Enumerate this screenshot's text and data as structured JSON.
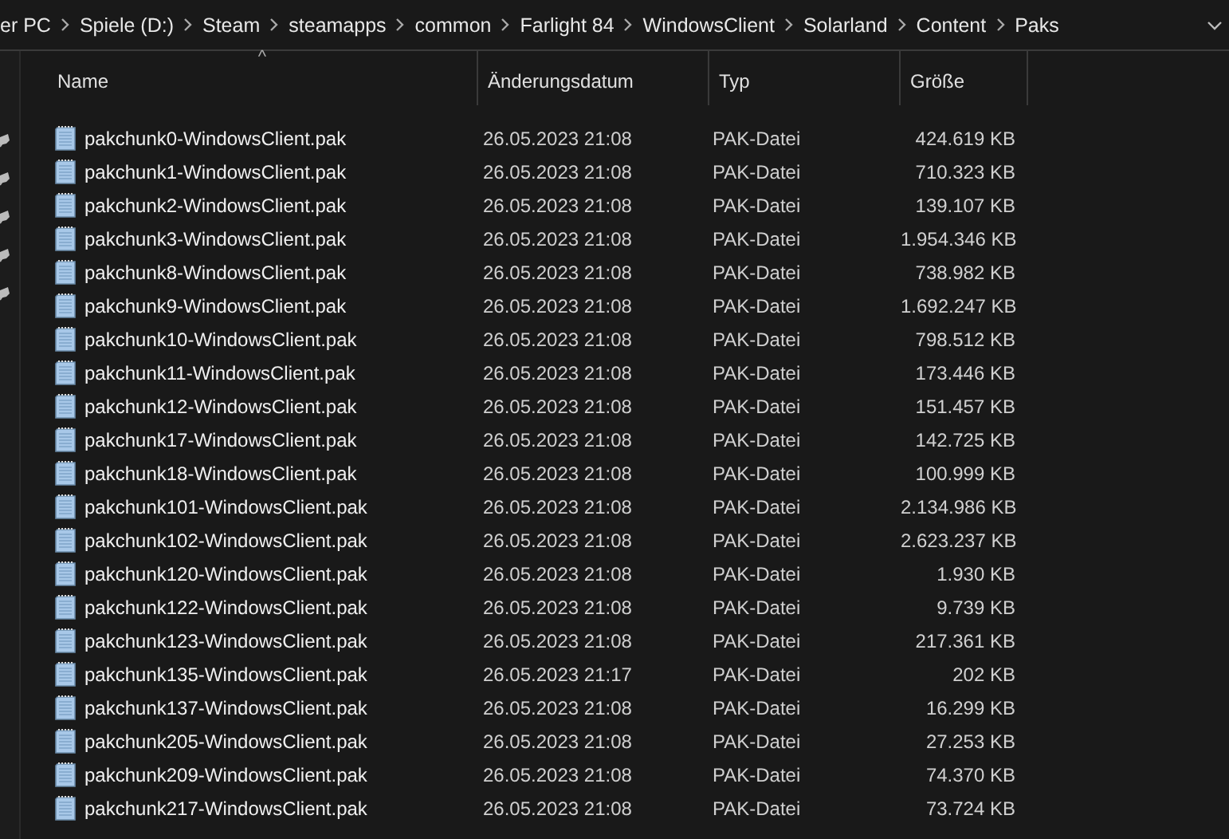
{
  "breadcrumb": [
    "er PC",
    "Spiele (D:)",
    "Steam",
    "steamapps",
    "common",
    "Farlight 84",
    "WindowsClient",
    "Solarland",
    "Content",
    "Paks"
  ],
  "columns": [
    {
      "label": "Name",
      "sorted": true
    },
    {
      "label": "Änderungsdatum",
      "sorted": false
    },
    {
      "label": "Typ",
      "sorted": false
    },
    {
      "label": "Größe",
      "sorted": false
    }
  ],
  "sort_indicator": "^",
  "files": [
    {
      "name": "pakchunk0-WindowsClient.pak",
      "date": "26.05.2023 21:08",
      "type": "PAK-Datei",
      "size": "424.619 KB"
    },
    {
      "name": "pakchunk1-WindowsClient.pak",
      "date": "26.05.2023 21:08",
      "type": "PAK-Datei",
      "size": "710.323 KB"
    },
    {
      "name": "pakchunk2-WindowsClient.pak",
      "date": "26.05.2023 21:08",
      "type": "PAK-Datei",
      "size": "139.107 KB"
    },
    {
      "name": "pakchunk3-WindowsClient.pak",
      "date": "26.05.2023 21:08",
      "type": "PAK-Datei",
      "size": "1.954.346 KB"
    },
    {
      "name": "pakchunk8-WindowsClient.pak",
      "date": "26.05.2023 21:08",
      "type": "PAK-Datei",
      "size": "738.982 KB"
    },
    {
      "name": "pakchunk9-WindowsClient.pak",
      "date": "26.05.2023 21:08",
      "type": "PAK-Datei",
      "size": "1.692.247 KB"
    },
    {
      "name": "pakchunk10-WindowsClient.pak",
      "date": "26.05.2023 21:08",
      "type": "PAK-Datei",
      "size": "798.512 KB"
    },
    {
      "name": "pakchunk11-WindowsClient.pak",
      "date": "26.05.2023 21:08",
      "type": "PAK-Datei",
      "size": "173.446 KB"
    },
    {
      "name": "pakchunk12-WindowsClient.pak",
      "date": "26.05.2023 21:08",
      "type": "PAK-Datei",
      "size": "151.457 KB"
    },
    {
      "name": "pakchunk17-WindowsClient.pak",
      "date": "26.05.2023 21:08",
      "type": "PAK-Datei",
      "size": "142.725 KB"
    },
    {
      "name": "pakchunk18-WindowsClient.pak",
      "date": "26.05.2023 21:08",
      "type": "PAK-Datei",
      "size": "100.999 KB"
    },
    {
      "name": "pakchunk101-WindowsClient.pak",
      "date": "26.05.2023 21:08",
      "type": "PAK-Datei",
      "size": "2.134.986 KB"
    },
    {
      "name": "pakchunk102-WindowsClient.pak",
      "date": "26.05.2023 21:08",
      "type": "PAK-Datei",
      "size": "2.623.237 KB"
    },
    {
      "name": "pakchunk120-WindowsClient.pak",
      "date": "26.05.2023 21:08",
      "type": "PAK-Datei",
      "size": "1.930 KB"
    },
    {
      "name": "pakchunk122-WindowsClient.pak",
      "date": "26.05.2023 21:08",
      "type": "PAK-Datei",
      "size": "9.739 KB"
    },
    {
      "name": "pakchunk123-WindowsClient.pak",
      "date": "26.05.2023 21:08",
      "type": "PAK-Datei",
      "size": "217.361 KB"
    },
    {
      "name": "pakchunk135-WindowsClient.pak",
      "date": "26.05.2023 21:17",
      "type": "PAK-Datei",
      "size": "202 KB"
    },
    {
      "name": "pakchunk137-WindowsClient.pak",
      "date": "26.05.2023 21:08",
      "type": "PAK-Datei",
      "size": "16.299 KB"
    },
    {
      "name": "pakchunk205-WindowsClient.pak",
      "date": "26.05.2023 21:08",
      "type": "PAK-Datei",
      "size": "27.253 KB"
    },
    {
      "name": "pakchunk209-WindowsClient.pak",
      "date": "26.05.2023 21:08",
      "type": "PAK-Datei",
      "size": "74.370 KB"
    },
    {
      "name": "pakchunk217-WindowsClient.pak",
      "date": "26.05.2023 21:08",
      "type": "PAK-Datei",
      "size": "73.724 KB"
    }
  ]
}
